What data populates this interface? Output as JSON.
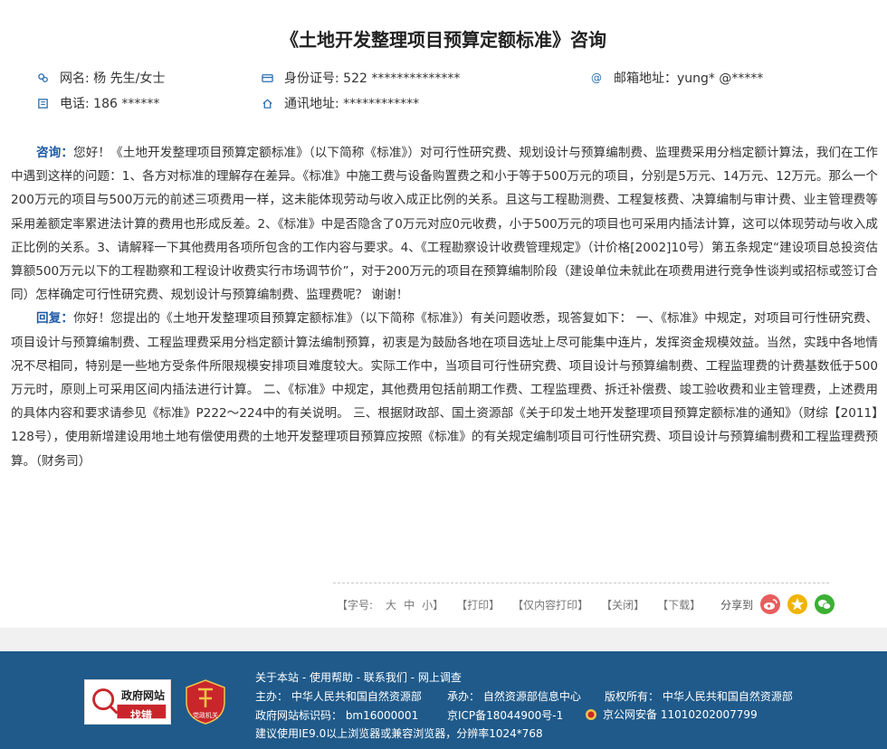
{
  "title": "《土地开发整理项目预算定额标准》咨询",
  "info": {
    "name": "网名: 杨 先生/女士",
    "idcard": "身份证号: 522 **************",
    "email": "邮箱地址：yung* @*****",
    "phone": "电话: 186 ******",
    "address": "通讯地址: ************"
  },
  "content": {
    "q_label": "咨询：",
    "q_text": "您好！《土地开发整理项目预算定额标准》（以下简称《标准》）对可行性研究费、规划设计与预算编制费、监理费采用分档定额计算法，我们在工作中遇到这样的问题：1、各方对标准的理解存在差异。《标准》中施工费与设备购置费之和小于等于500万元的项目，分别是5万元、14万元、12万元。那么一个200万元的项目与500万元的前述三项费用一样，这未能体现劳动与收入成正比例的关系。且这与工程勘测费、工程复核费、决算编制与审计费、业主管理费等采用差额定率累进法计算的费用也形成反差。2、《标准》中是否隐含了0万元对应0元收费，小于500万元的项目也可采用内插法计算，这可以体现劳动与收入成正比例的关系。3、请解释一下其他费用各项所包含的工作内容与要求。4、《工程勘察设计收费管理规定》（计价格[2002]10号）第五条规定“建设项目总投资估算额500万元以下的工程勘察和工程设计收费实行市场调节价”，对于200万元的项目在预算编制阶段（建设单位未就此在项费用进行竞争性谈判或招标或签订合同）怎样确定可行性研究费、规划设计与预算编制费、监理费呢？ 谢谢！",
    "a_label": "回复：",
    "a_text": "你好！您提出的《土地开发整理项目预算定额标准》（以下简称《标准》）有关问题收悉，现答复如下： 一、《标准》中规定，对项目可行性研究费、项目设计与预算编制费、工程监理费采用分档定额计算法编制预算，初衷是为鼓励各地在项目选址上尽可能集中连片，发挥资金规模效益。当然，实践中各地情况不尽相同，特别是一些地方受条件所限规模安排项目难度较大。实际工作中，当项目可行性研究费、项目设计与预算编制费、工程监理费的计费基数低于500万元时，原则上可采用区间内插法进行计算。 二、《标准》中规定，其他费用包括前期工作费、工程监理费、拆迁补偿费、竣工验收费和业主管理费，上述费用的具体内容和要求请参见《标准》P222～224中的有关说明。 三、根据财政部、国土资源部《关于印发土地开发整理项目预算定额标准的通知》（财综【2011】128号），使用新增建设用地土地有偿使用费的土地开发整理项目预算应按照《标准》的有关规定编制项目可行性研究费、项目设计与预算编制费和工程监理费预算。（财务司）"
  },
  "tools": {
    "font_label": "【字号:",
    "font_big": "大",
    "font_mid": "中",
    "font_small": "小】",
    "print": "【打印】",
    "print_content": "【仅内容打印】",
    "close": "【关闭】",
    "download": "【下载】",
    "share": "分享到"
  },
  "footer": {
    "links": "关于本站 - 使用帮助 - 联系我们 - 网上调查",
    "host": "主办：  中华人民共和国自然资源部",
    "undertake": "承办：  自然资源部信息中心",
    "copyright": "版权所有：  中华人民共和国自然资源部",
    "site_id": "政府网站标识码：  bm16000001",
    "icp": "京ICP备18044900号-1",
    "police": "京公网安备 11010202007799",
    "browser": "建议使用IE9.0以上浏览器或兼容浏览器，分辨率1024*768",
    "badge1_top": "政府网站",
    "badge1_bottom": "找错",
    "badge2": "党政机关"
  },
  "colors": {
    "accent": "#1f5aa6",
    "footer_bg": "#1f5a8a",
    "weibo": "#e85d5d",
    "star": "#f0b400",
    "wechat": "#3cb034"
  }
}
